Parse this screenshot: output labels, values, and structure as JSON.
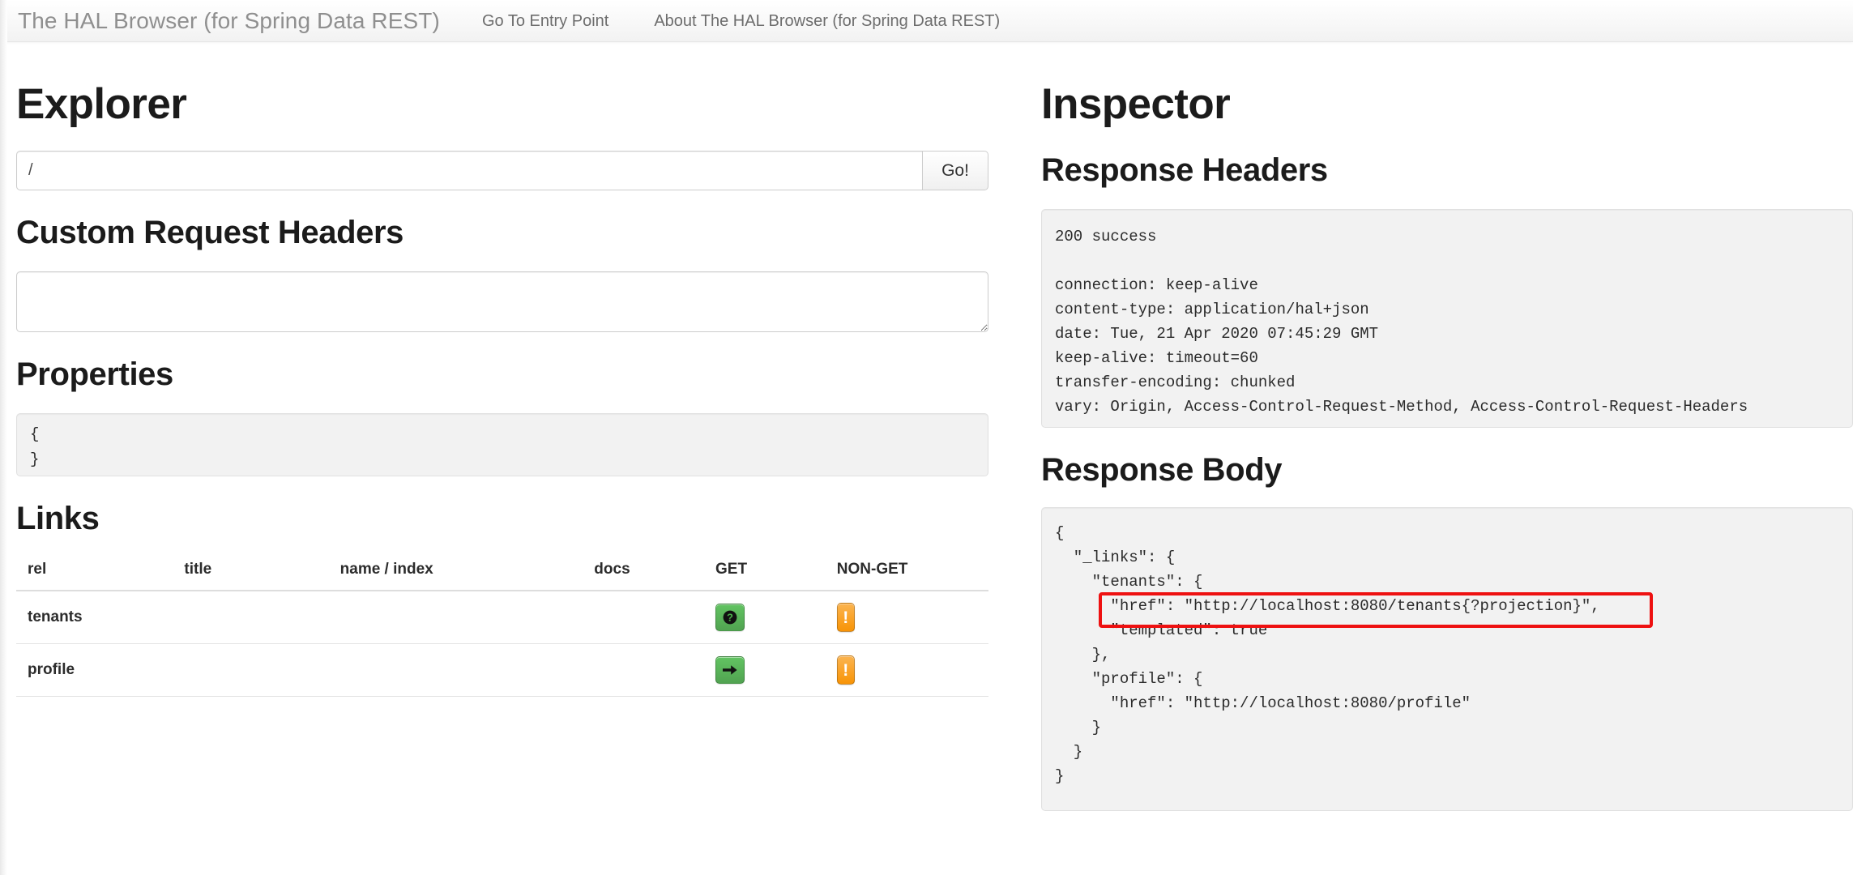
{
  "navbar": {
    "brand": "The HAL Browser (for Spring Data REST)",
    "links": [
      {
        "label": "Go To Entry Point"
      },
      {
        "label": "About The HAL Browser (for Spring Data REST)"
      }
    ]
  },
  "explorer": {
    "title": "Explorer",
    "url_value": "/",
    "url_placeholder": "/",
    "go_label": "Go!",
    "custom_headers_title": "Custom Request Headers",
    "custom_headers_value": "",
    "custom_headers_placeholder": "",
    "properties_title": "Properties",
    "properties_body": "{\n}",
    "links_title": "Links",
    "links_table": {
      "columns": [
        "rel",
        "title",
        "name / index",
        "docs",
        "GET",
        "NON-GET"
      ],
      "rows": [
        {
          "rel": "tenants",
          "title": "",
          "name_index": "",
          "docs": "",
          "get_icon": "question-mark-icon",
          "get_label": "",
          "nonget_icon": "exclamation-icon",
          "nonget_label": "!"
        },
        {
          "rel": "profile",
          "title": "",
          "name_index": "",
          "docs": "",
          "get_icon": "arrow-right-icon",
          "get_label": "",
          "nonget_icon": "exclamation-icon",
          "nonget_label": "!"
        }
      ]
    }
  },
  "inspector": {
    "title": "Inspector",
    "response_headers_title": "Response Headers",
    "response_headers_status": "200 success",
    "response_headers_body": "connection: keep-alive\ncontent-type: application/hal+json\ndate: Tue, 21 Apr 2020 07:45:29 GMT\nkeep-alive: timeout=60\ntransfer-encoding: chunked\nvary: Origin, Access-Control-Request-Method, Access-Control-Request-Headers",
    "response_body_title": "Response Body",
    "response_body": "{\n  \"_links\": {\n    \"tenants\": {\n      \"href\": \"http://localhost:8080/tenants{?projection}\",\n      \"templated\": true\n    },\n    \"profile\": {\n      \"href\": \"http://localhost:8080/profile\"\n    }\n  }\n}",
    "highlight": {
      "annotation_color": "#ee1111",
      "highlighted_text": "\"href\": \"http://localhost:8080/tenants{?projection}\","
    }
  },
  "colors": {
    "green_button": "#51a351",
    "orange_button": "#f89406",
    "annotation_red": "#ee1111",
    "well_background": "#f2f2f2",
    "brand_text": "#8f8f8f"
  }
}
